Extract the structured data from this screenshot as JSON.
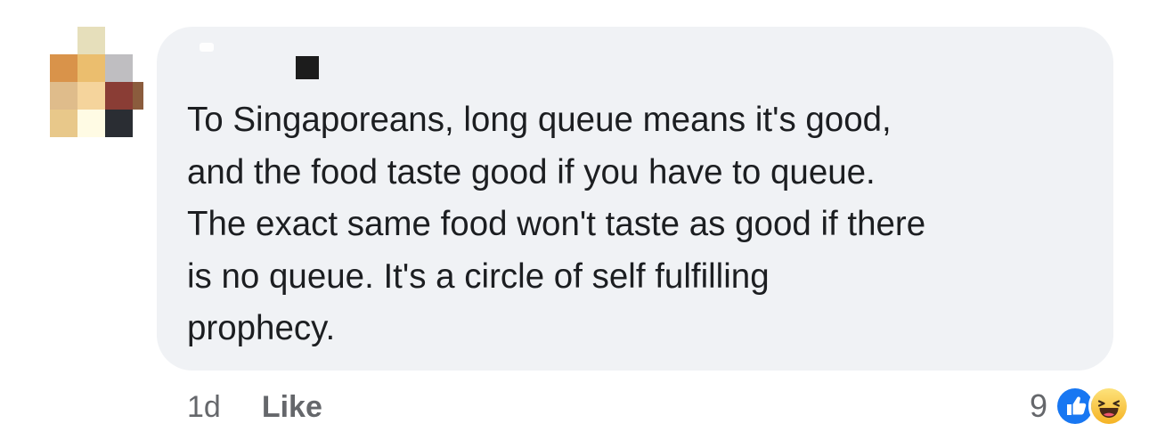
{
  "comment": {
    "text": "To Singaporeans, long queue means it's good,\nand the food taste good if you have to queue.\nThe exact same food won't taste as good if there\nis no queue. It's a circle of self fulfilling\nprophecy."
  },
  "footer": {
    "timestamp": "1d",
    "like_label": "Like",
    "reaction_count": "9"
  },
  "reactions": [
    "like-icon",
    "haha-icon"
  ],
  "colors": {
    "bubble": "#f0f2f5",
    "text": "#1c1e21",
    "secondary": "#65676b",
    "like_blue": "#1877f2",
    "haha_yellow": "#f7c33b"
  }
}
